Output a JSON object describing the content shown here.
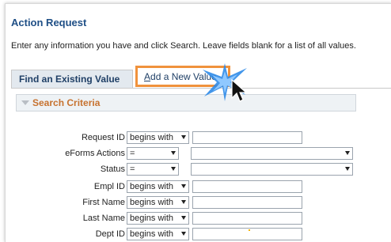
{
  "page": {
    "title": "Action Request",
    "instructions": "Enter any information you have and click Search. Leave fields blank for a list of all values."
  },
  "tabs": [
    {
      "label": "Find an Existing Value"
    },
    {
      "label_prefix": "A",
      "label_rest": "dd a New Value"
    }
  ],
  "criteria": {
    "header": "Search Criteria",
    "fields": [
      {
        "label": "Request ID",
        "operator": "begins with",
        "type": "text"
      },
      {
        "label": "eForms Actions",
        "operator": "=",
        "type": "select"
      },
      {
        "label": "Status",
        "operator": "=",
        "type": "select"
      },
      {
        "label": "Empl ID",
        "operator": "begins with",
        "type": "text"
      },
      {
        "label": "First Name",
        "operator": "begins with",
        "type": "text"
      },
      {
        "label": "Last Name",
        "operator": "begins with",
        "type": "text"
      },
      {
        "label": "Dept ID",
        "operator": "begins with",
        "type": "text"
      }
    ]
  },
  "colors": {
    "title": "#1f4f86",
    "highlight": "#f0923c",
    "criteria_header": "#c7722f",
    "star": "#2f8be8"
  },
  "icons": {
    "collapse": "triangle-down-icon",
    "pointer": "mouse-pointer-icon",
    "burst": "click-burst-icon"
  }
}
